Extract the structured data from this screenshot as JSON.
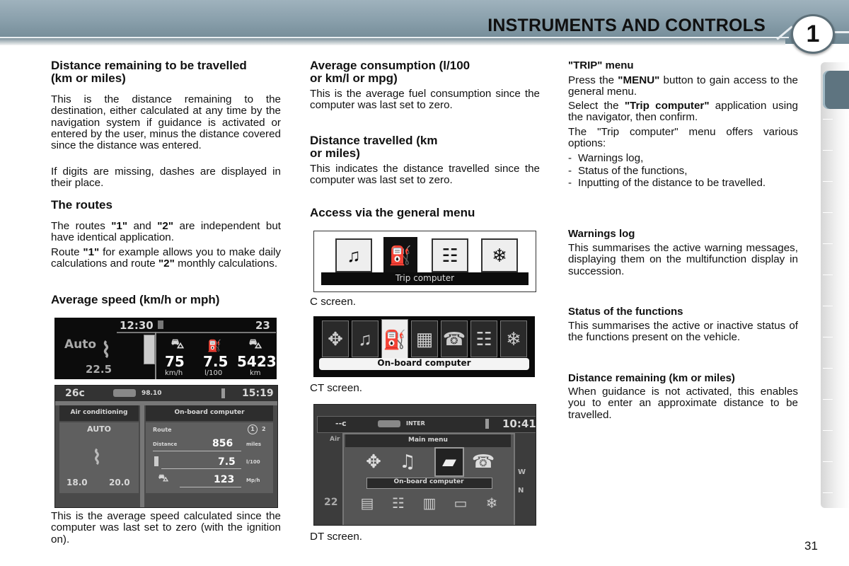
{
  "header": {
    "title": "INSTRUMENTS AND CONTROLS",
    "chapter": "1"
  },
  "page_number": "31",
  "col1": {
    "dist_remaining_title": "Distance remaining to be travelled (km or miles)",
    "dist_remaining_p1": "This is the distance remaining to the destination, either calculated at any time by the navigation system if guidance is activated or entered by the user, minus the distance covered since the distance was entered.",
    "dist_remaining_p2": "If digits are missing, dashes are displayed in their place.",
    "routes_title": "The routes",
    "routes_p1_a": "The routes ",
    "routes_p1_b1": "\"1\"",
    "routes_p1_c": " and ",
    "routes_p1_b2": "\"2\"",
    "routes_p1_d": " are independent but have identical application.",
    "routes_p2_a": "Route ",
    "routes_p2_b1": "\"1\"",
    "routes_p2_c": " for example allows you to make daily calculations and route ",
    "routes_p2_b2": "\"2\"",
    "routes_p2_d": " monthly calculations.",
    "avg_speed_title": "Average speed (km/h or mph)",
    "avg_speed_p": "This is the average speed calculated since the computer was last set to zero (with the ignition on)."
  },
  "screen1": {
    "time": "12:30",
    "temp_right": "23",
    "ac_mode": "Auto",
    "ac_temp": "22.5",
    "speed_value": "75",
    "speed_unit": "km/h",
    "consumption_value": "7.5",
    "consumption_unit": "l/100",
    "range_value": "5423",
    "range_unit": "km"
  },
  "screen2": {
    "outside_temp": "26c",
    "radio": "98.10",
    "time": "15:19",
    "ac_title": "Air conditioning",
    "ac_mode": "AUTO",
    "temp_left": "18.0",
    "temp_right": "20.0",
    "computer_title": "On-board computer",
    "route_label": "Route",
    "route_selected": "1",
    "route_other": "2",
    "distance_label": "Distance",
    "distance_value": "856",
    "distance_unit": "miles",
    "consumption_value": "7.5",
    "consumption_unit": "l/100",
    "speed_value": "123",
    "speed_unit": "Mp/h"
  },
  "col2": {
    "avg_cons_title": "Average consumption (l/100 or km/l or mpg)",
    "avg_cons_p": "This is the average fuel consumption since the computer was last set to zero.",
    "dist_travelled_title": "Distance travelled (km or miles)",
    "dist_travelled_p": "This indicates the distance travelled since the computer was last set to zero.",
    "access_title": "Access via the general menu",
    "c_caption": "C screen.",
    "ct_caption": "CT screen.",
    "dt_caption": "DT screen."
  },
  "screenC": {
    "label": "Trip computer",
    "icons": [
      "audio-icon",
      "fuel-pump-icon",
      "settings-sliders-icon",
      "climate-icon"
    ]
  },
  "screenCT": {
    "label": "On-board computer",
    "icons": [
      "navigation-icon",
      "audio-icon",
      "fuel-pump-icon",
      "diagnostics-icon",
      "telephone-icon",
      "settings-sliders-icon",
      "climate-icon"
    ]
  },
  "screenDT": {
    "top_left": "--c",
    "radio": "INTER",
    "time": "10:41",
    "menu_title": "Main menu",
    "selected_label": "On-board computer",
    "side_left_top": "Air",
    "side_left_bottom": "22",
    "side_right_1": "W",
    "side_right_2": "N",
    "row1_icons": [
      "navigation-icon",
      "audio-icon",
      "on-board-computer-icon",
      "telephone-icon"
    ],
    "row2_icons": [
      "video-icon",
      "settings-sliders-icon",
      "map-icon",
      "tv-icon",
      "climate-icon"
    ]
  },
  "col3": {
    "trip_title": "\"TRIP\" menu",
    "trip_p1_a": "Press the ",
    "trip_p1_b": "\"MENU\"",
    "trip_p1_c": " button to gain access to the general menu.",
    "trip_p2_a": "Select the ",
    "trip_p2_b": "\"Trip computer\"",
    "trip_p2_c": " application using the navigator, then confirm.",
    "trip_p3": "The \"Trip computer\" menu offers various options:",
    "options": [
      "Warnings log,",
      "Status of the functions,",
      "Inputting of the distance to be travelled."
    ],
    "warnings_title": "Warnings log",
    "warnings_p": "This summarises the active warning messages, displaying them on the multifunction display in succession.",
    "status_title": "Status of the functions",
    "status_p": "This summarises the active or inactive status of the functions present on the vehicle.",
    "dist_rem_title": "Distance remaining (km or miles)",
    "dist_rem_p": "When guidance is not activated, this enables you to enter an approximate distance to be travelled."
  }
}
